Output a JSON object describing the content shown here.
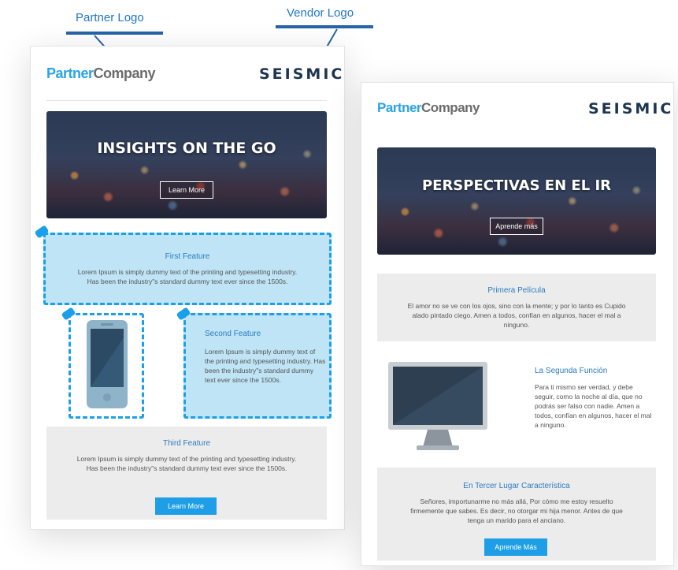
{
  "callouts": {
    "partner_logo": "Partner Logo",
    "vendor_logo": "Vendor Logo"
  },
  "left": {
    "partner_logo": {
      "prefix": "Partner",
      "suffix": "Company"
    },
    "vendor_logo": "SEISMIC",
    "hero": {
      "title": "INSIGHTS ON THE GO",
      "button": "Learn More"
    },
    "feature1": {
      "title": "First Feature",
      "text": "Lorem Ipsum is simply dummy text of the printing and typesetting industry. Has been the industry\"s standard dummy text ever since the 1500s."
    },
    "feature2": {
      "title": "Second Feature",
      "text": "Lorem Ipsum is simply dummy text of the printing and typesetting industry. Has been the industry\"s standard dummy text ever since the 1500s."
    },
    "feature3": {
      "title": "Third Feature",
      "text": "Lorem Ipsum is simply dummy text of the printing and typesetting industry. Has been the industry\"s standard dummy text ever since the 1500s.",
      "button": "Learn More"
    }
  },
  "right": {
    "partner_logo": {
      "prefix": "Partner",
      "suffix": "Company"
    },
    "vendor_logo": "SEISMIC",
    "hero": {
      "title": "PERSPECTIVAS EN EL IR",
      "button": "Aprende más"
    },
    "feature1": {
      "title": "Primera Película",
      "text": "El amor no se ve con los ojos, sino con la mente; y por lo tanto es Cupido alado pintado ciego. Amen a todos, confían en algunos, hacer el mal a ninguno."
    },
    "feature2": {
      "title": "La Segunda Función",
      "text": "Para ti mismo ser verdad, y debe seguir, como la noche al día, que no podrás ser falso con nadie. Amen a todos, confían en algunos, hacer el mal a ninguno."
    },
    "feature3": {
      "title": "En Tercer Lugar Característica",
      "text": "Señores, importunarme no más allá, Por cómo me estoy resuelto firmemente que sabes. Es decir, no otorgar mi hija menor. Antes de que tenga un marido para el anciano.",
      "button": "Aprende Más"
    }
  },
  "icons": {
    "phone": "smartphone-icon",
    "monitor": "desktop-monitor-icon"
  },
  "colors": {
    "accent": "#1aa0e8",
    "callout": "#2765a8",
    "brand_dark": "#1c3550",
    "button": "#1e9ee6"
  }
}
